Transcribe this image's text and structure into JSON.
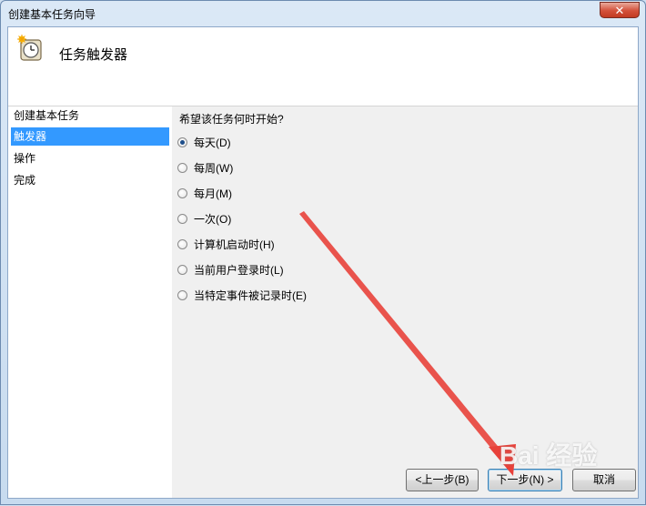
{
  "window": {
    "title": "创建基本任务向导",
    "close_label": "✕"
  },
  "header": {
    "title": "任务触发器"
  },
  "nav": {
    "items": [
      {
        "label": "创建基本任务"
      },
      {
        "label": "触发器"
      },
      {
        "label": "操作"
      },
      {
        "label": "完成"
      }
    ],
    "active_index": 1
  },
  "main": {
    "question": "希望该任务何时开始?",
    "options": [
      {
        "label": "每天(D)",
        "checked": true
      },
      {
        "label": "每周(W)",
        "checked": false
      },
      {
        "label": "每月(M)",
        "checked": false
      },
      {
        "label": "一次(O)",
        "checked": false
      },
      {
        "label": "计算机启动时(H)",
        "checked": false
      },
      {
        "label": "当前用户登录时(L)",
        "checked": false
      },
      {
        "label": "当特定事件被记录时(E)",
        "checked": false
      }
    ]
  },
  "buttons": {
    "back": "<上一步(B)",
    "next": "下一步(N) >",
    "cancel": "取消"
  },
  "watermark": "Bai 经验",
  "colors": {
    "accent": "#3399ff",
    "annotation_arrow": "#e8413a",
    "close": "#c23a22"
  }
}
